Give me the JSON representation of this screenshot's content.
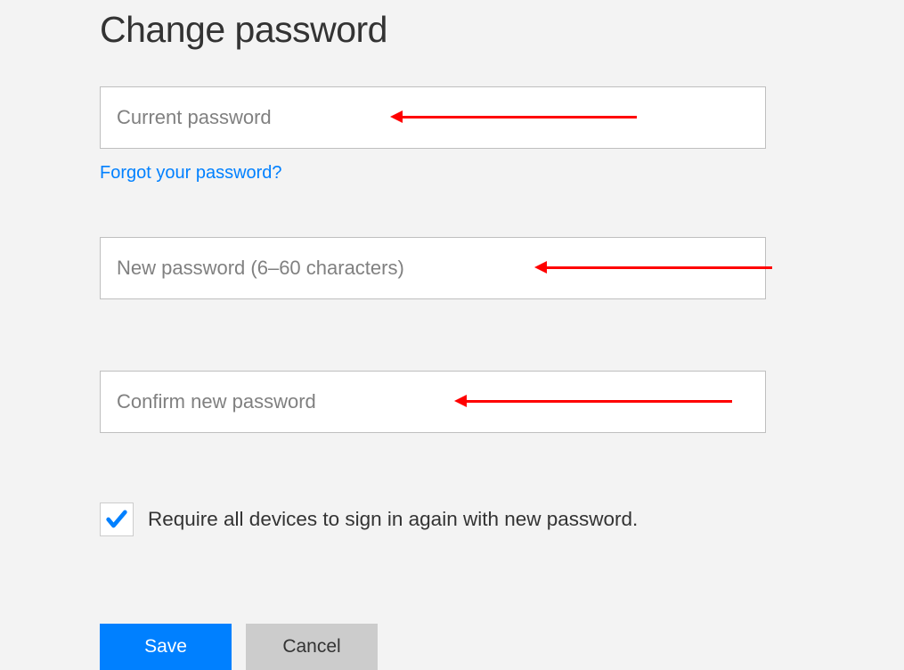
{
  "title": "Change password",
  "fields": {
    "current_password": {
      "placeholder": "Current password",
      "value": ""
    },
    "new_password": {
      "placeholder": "New password (6–60 characters)",
      "value": ""
    },
    "confirm_password": {
      "placeholder": "Confirm new password",
      "value": ""
    }
  },
  "forgot_link": "Forgot your password?",
  "checkbox": {
    "label": "Require all devices to sign in again with new password.",
    "checked": true
  },
  "buttons": {
    "save": "Save",
    "cancel": "Cancel"
  },
  "colors": {
    "primary": "#0080ff",
    "arrow": "#ff0000",
    "background": "#f3f3f3"
  }
}
